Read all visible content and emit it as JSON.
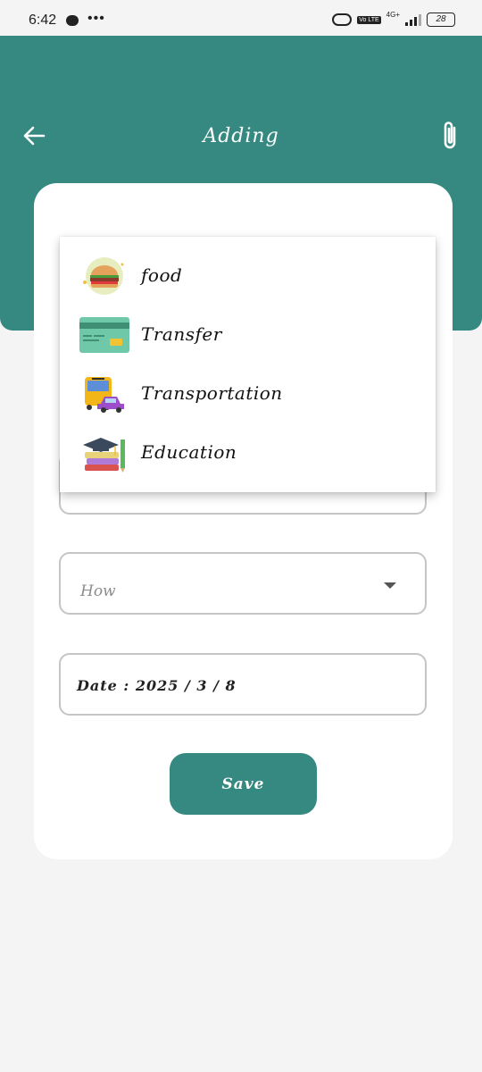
{
  "status_bar": {
    "time": "6:42",
    "dots": "•••",
    "network": "4G+",
    "volte": "Vo LTE",
    "battery": "28"
  },
  "header": {
    "title": "Adding"
  },
  "category_menu": {
    "items": [
      {
        "label": "food",
        "icon": "burger-icon"
      },
      {
        "label": "Transfer",
        "icon": "credit-card-icon"
      },
      {
        "label": "Transportation",
        "icon": "bus-car-icon"
      },
      {
        "label": "Education",
        "icon": "books-icon"
      }
    ]
  },
  "form": {
    "how_placeholder": "How",
    "date_text": "Date : 2025 / 3 / 8",
    "save_label": "Save"
  },
  "colors": {
    "primary": "#368981",
    "background": "#f4f4f4",
    "card": "#ffffff",
    "field_border": "#c5c5c5"
  }
}
